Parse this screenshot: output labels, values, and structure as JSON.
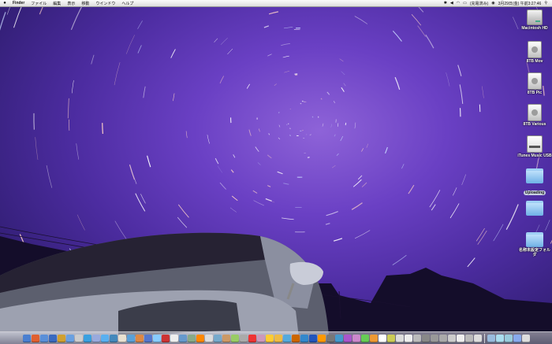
{
  "menubar": {
    "app": "Finder",
    "menus": [
      "ファイル",
      "編集",
      "表示",
      "移動",
      "ウインドウ",
      "ヘルプ"
    ],
    "status_text": "(充電済み)",
    "clock": "3月29日(金) 午前3:27:46",
    "icons": [
      "apple-icon",
      "bluetooth-icon",
      "volume-icon",
      "wifi-icon",
      "battery-icon",
      "user-icon",
      "spotlight-icon"
    ]
  },
  "desktop_icons": [
    {
      "label": "Macintosh HD",
      "icon": "hard-drive-icon",
      "selected": false
    },
    {
      "label": "8TB Mov",
      "icon": "external-drive-icon",
      "selected": false
    },
    {
      "label": "8TB Pic",
      "icon": "external-drive-icon",
      "selected": false
    },
    {
      "label": "8TB Various",
      "icon": "external-drive-icon",
      "selected": false
    },
    {
      "label": "iTunes Music USB",
      "icon": "usb-drive-icon",
      "selected": false
    },
    {
      "label": "Uploading",
      "icon": "folder-icon",
      "selected": true
    },
    {
      "label": "",
      "icon": "folder-icon",
      "selected": false
    },
    {
      "label": "名称未設定フォルダ",
      "icon": "folder-icon",
      "selected": false
    }
  ],
  "dock": {
    "colors": [
      "#4a7fd0",
      "#e06030",
      "#5a8fd8",
      "#3a6abf",
      "#d0a030",
      "#6aa0e0",
      "#ccc",
      "#3aa0e0",
      "#9ad",
      "#5ab0f0",
      "#48b",
      "#e8e0d0",
      "#5aa0d8",
      "#d84",
      "#57c",
      "#8cf",
      "#c33",
      "#eee",
      "#69c",
      "#8a8",
      "#f80",
      "#ddd",
      "#7ac",
      "#c96",
      "#9c6",
      "#aaa",
      "#e33",
      "#c9b",
      "#fc3",
      "#eb4",
      "#5ad",
      "#c60",
      "#38c",
      "#25b",
      "#f90",
      "#777",
      "#49c",
      "#a5c",
      "#c8c",
      "#6c5",
      "#e93",
      "#fff",
      "#cc5",
      "#ddd",
      "#eee",
      "#bbb",
      "#888",
      "#999",
      "#aaa",
      "#ccc",
      "#eee",
      "#bbb",
      "#ddd",
      "#9bd",
      "#ade",
      "#9cd",
      "#8ae",
      "#ddd"
    ]
  }
}
